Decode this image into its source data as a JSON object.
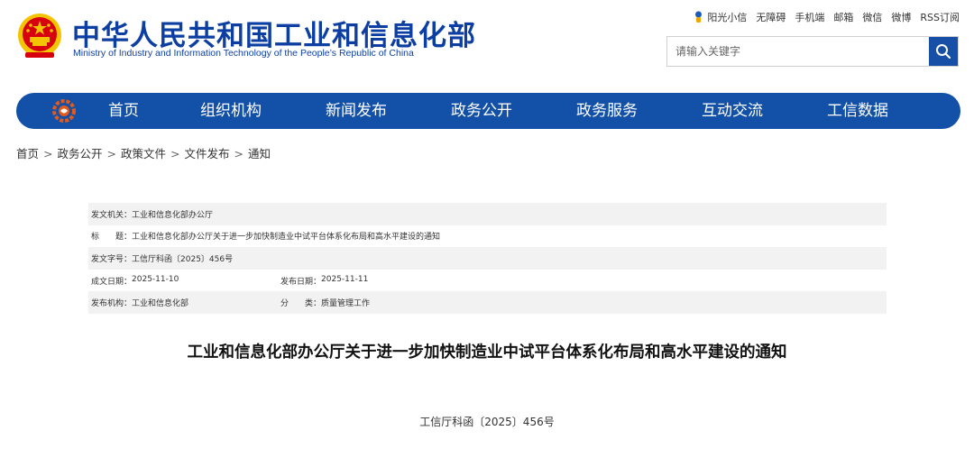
{
  "header": {
    "site_title": "中华人民共和国工业和信息化部",
    "site_subtitle": "Ministry of Industry and Information Technology of the People’s Republic of China",
    "top_links": [
      "阳光小信",
      "无障碍",
      "手机端",
      "邮箱",
      "微信",
      "微博",
      "RSS订阅"
    ],
    "search_placeholder": "请输入关键字",
    "colors": {
      "brand_blue": "#0d3fa3",
      "nav_blue": "#1350a7",
      "emblem_red": "#d7000f",
      "emblem_gold": "#f5c400"
    }
  },
  "nav": {
    "items": [
      "首页",
      "组织机构",
      "新闻发布",
      "政务公开",
      "政务服务",
      "互动交流",
      "工信数据"
    ]
  },
  "breadcrumb": {
    "items": [
      "首页",
      "政务公开",
      "政策文件",
      "文件发布",
      "通知"
    ],
    "separator": ">"
  },
  "meta": {
    "issuer_label": "发文机关：",
    "issuer": "工业和信息化部办公厅",
    "title_label": "标　　题：",
    "title": "工业和信息化部办公厅关于进一步加快制造业中试平台体系化布局和高水平建设的通知",
    "doc_no_label": "发文字号：",
    "doc_no": "工信厅科函〔2025〕456号",
    "created_label": "成文日期：",
    "created": "2025-11-10",
    "published_label": "发布日期：",
    "published": "2025-11-11",
    "org_label": "发布机构：",
    "org": "工业和信息化部",
    "category_label": "分　　类：",
    "category": "质量管理工作"
  },
  "document": {
    "title": "工业和信息化部办公厅关于进一步加快制造业中试平台体系化布局和高水平建设的通知",
    "number": "工信厅科函〔2025〕456号"
  }
}
